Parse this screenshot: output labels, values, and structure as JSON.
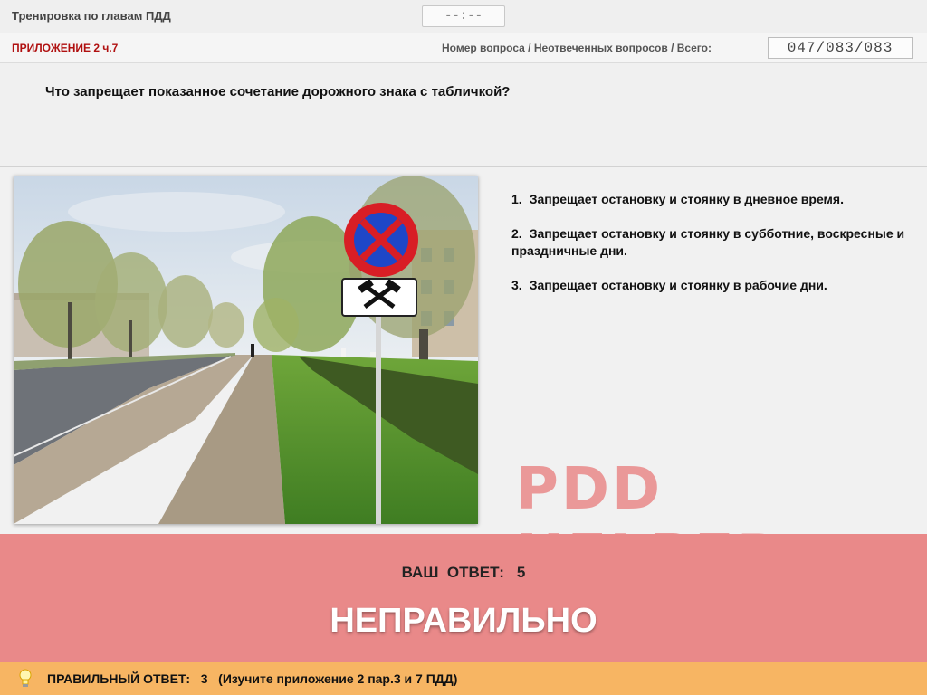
{
  "topbar": {
    "title": "Тренировка по главам ПДД",
    "timer": "--:--"
  },
  "subbar": {
    "section": "ПРИЛОЖЕНИЕ 2 ч.7",
    "counter_label": "Номер вопроса / Неотвеченных вопросов / Всего:",
    "counter_value": "047/083/083"
  },
  "question": {
    "text": "Что запрещает показанное сочетание дорожного знака с табличкой?"
  },
  "answers": [
    {
      "num": "1.",
      "text": "Запрещает остановку и стоянку в дневное время."
    },
    {
      "num": "2.",
      "text": "Запрещает остановку и стоянку в субботние, воскресные и праздничные дни."
    },
    {
      "num": "3.",
      "text": "Запрещает остановку и стоянку в рабочие дни."
    }
  ],
  "watermark": "PDD HELPER",
  "result": {
    "your_answer_label": "ВАШ  ОТВЕТ:",
    "your_answer_value": "5",
    "verdict": "НЕПРАВИЛЬНО"
  },
  "hint": {
    "icon": "lightbulb-icon",
    "label": "ПРАВИЛЬНЫЙ ОТВЕТ:",
    "value": "3",
    "note": "(Изучите приложение 2 пар.3 и 7 ПДД)"
  },
  "colors": {
    "section_red": "#b01010",
    "result_bg": "#e98989",
    "hint_bg": "#f7b563",
    "watermark": "#ea8f8f"
  }
}
